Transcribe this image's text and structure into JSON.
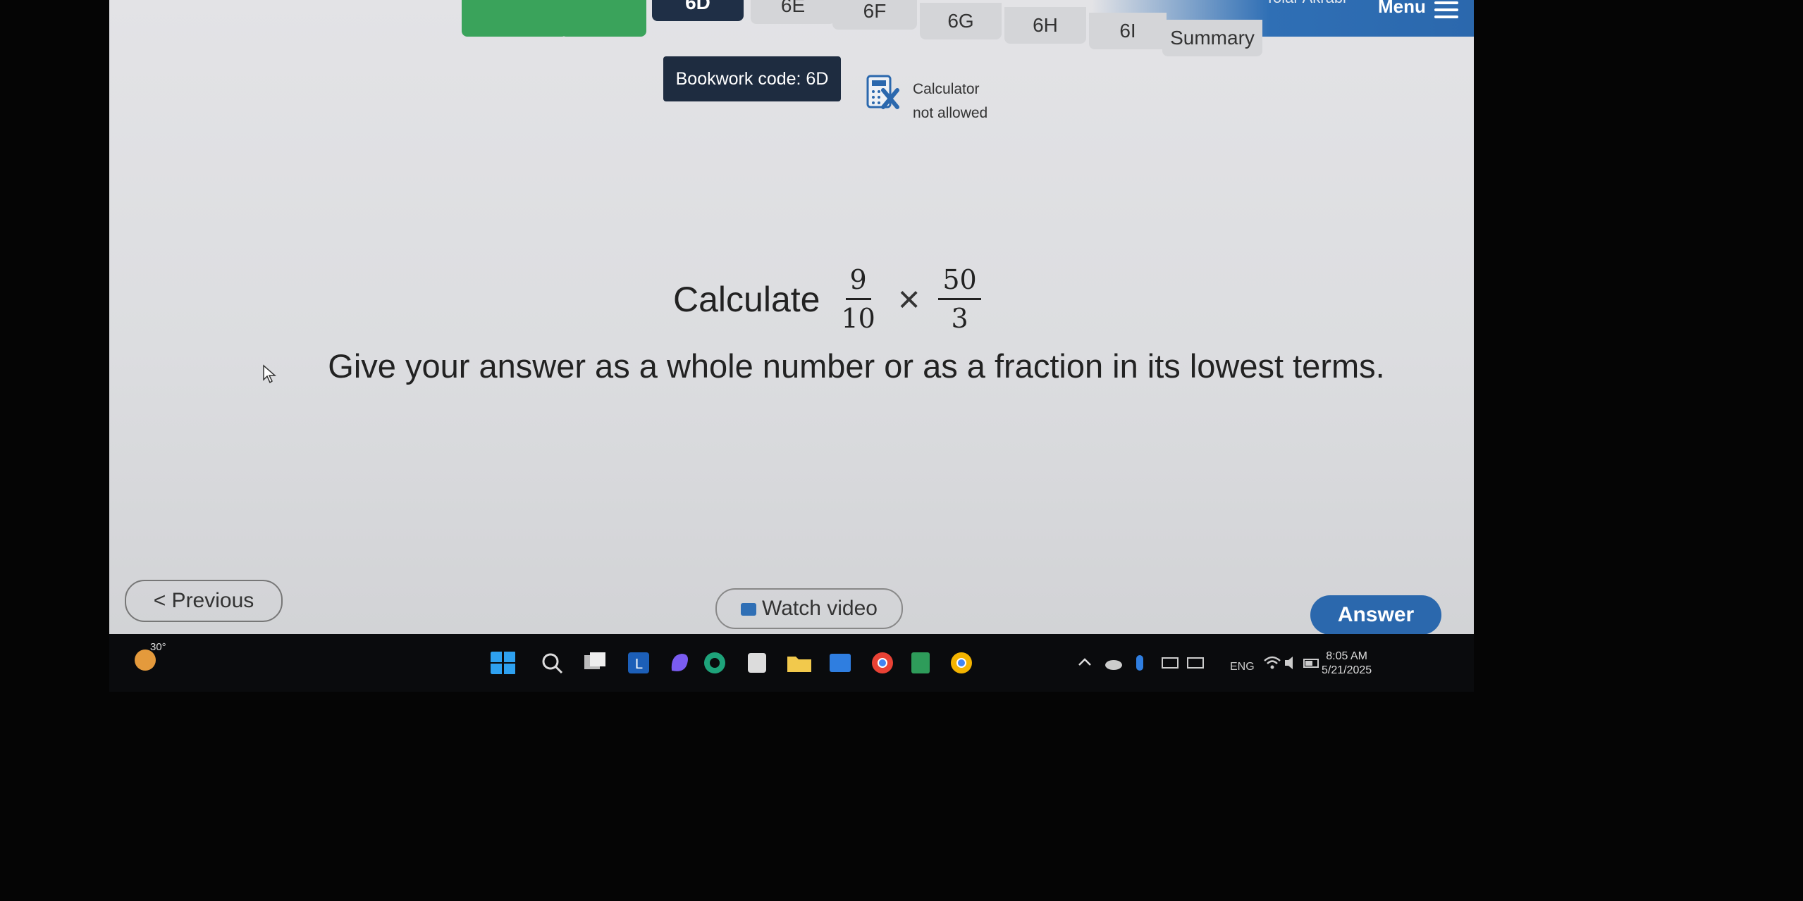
{
  "header": {
    "tabs": [
      {
        "label": ""
      },
      {
        "label": ""
      },
      {
        "label": "6D"
      },
      {
        "label": "6E"
      },
      {
        "label": "6F"
      },
      {
        "label": "6G"
      },
      {
        "label": "6H"
      },
      {
        "label": "6I"
      },
      {
        "label": "Summary"
      }
    ],
    "active_tab": "6D",
    "menu_label": "Menu",
    "user_name": "Tolar Akrabi"
  },
  "bookwork": {
    "label": "Bookwork code: 6D"
  },
  "calculator": {
    "line1": "Calculator",
    "line2": "not allowed"
  },
  "question": {
    "prefix": "Calculate",
    "fraction1": {
      "numerator": "9",
      "denominator": "10"
    },
    "operator": "×",
    "fraction2": {
      "numerator": "50",
      "denominator": "3"
    }
  },
  "instruction": "Give your answer as a whole number or as a fraction in its lowest terms.",
  "buttons": {
    "previous": "< Previous",
    "watch_video": "Watch video",
    "answer": "Answer"
  },
  "taskbar": {
    "temperature": "30°",
    "language": "ENG",
    "time": "8:05 AM",
    "date": "5/21/2025"
  },
  "colors": {
    "active_tab": "#1f2f46",
    "completed_tab": "#3aa35b",
    "accent": "#2b68ad",
    "calculator_cross": "#2b68ad"
  }
}
